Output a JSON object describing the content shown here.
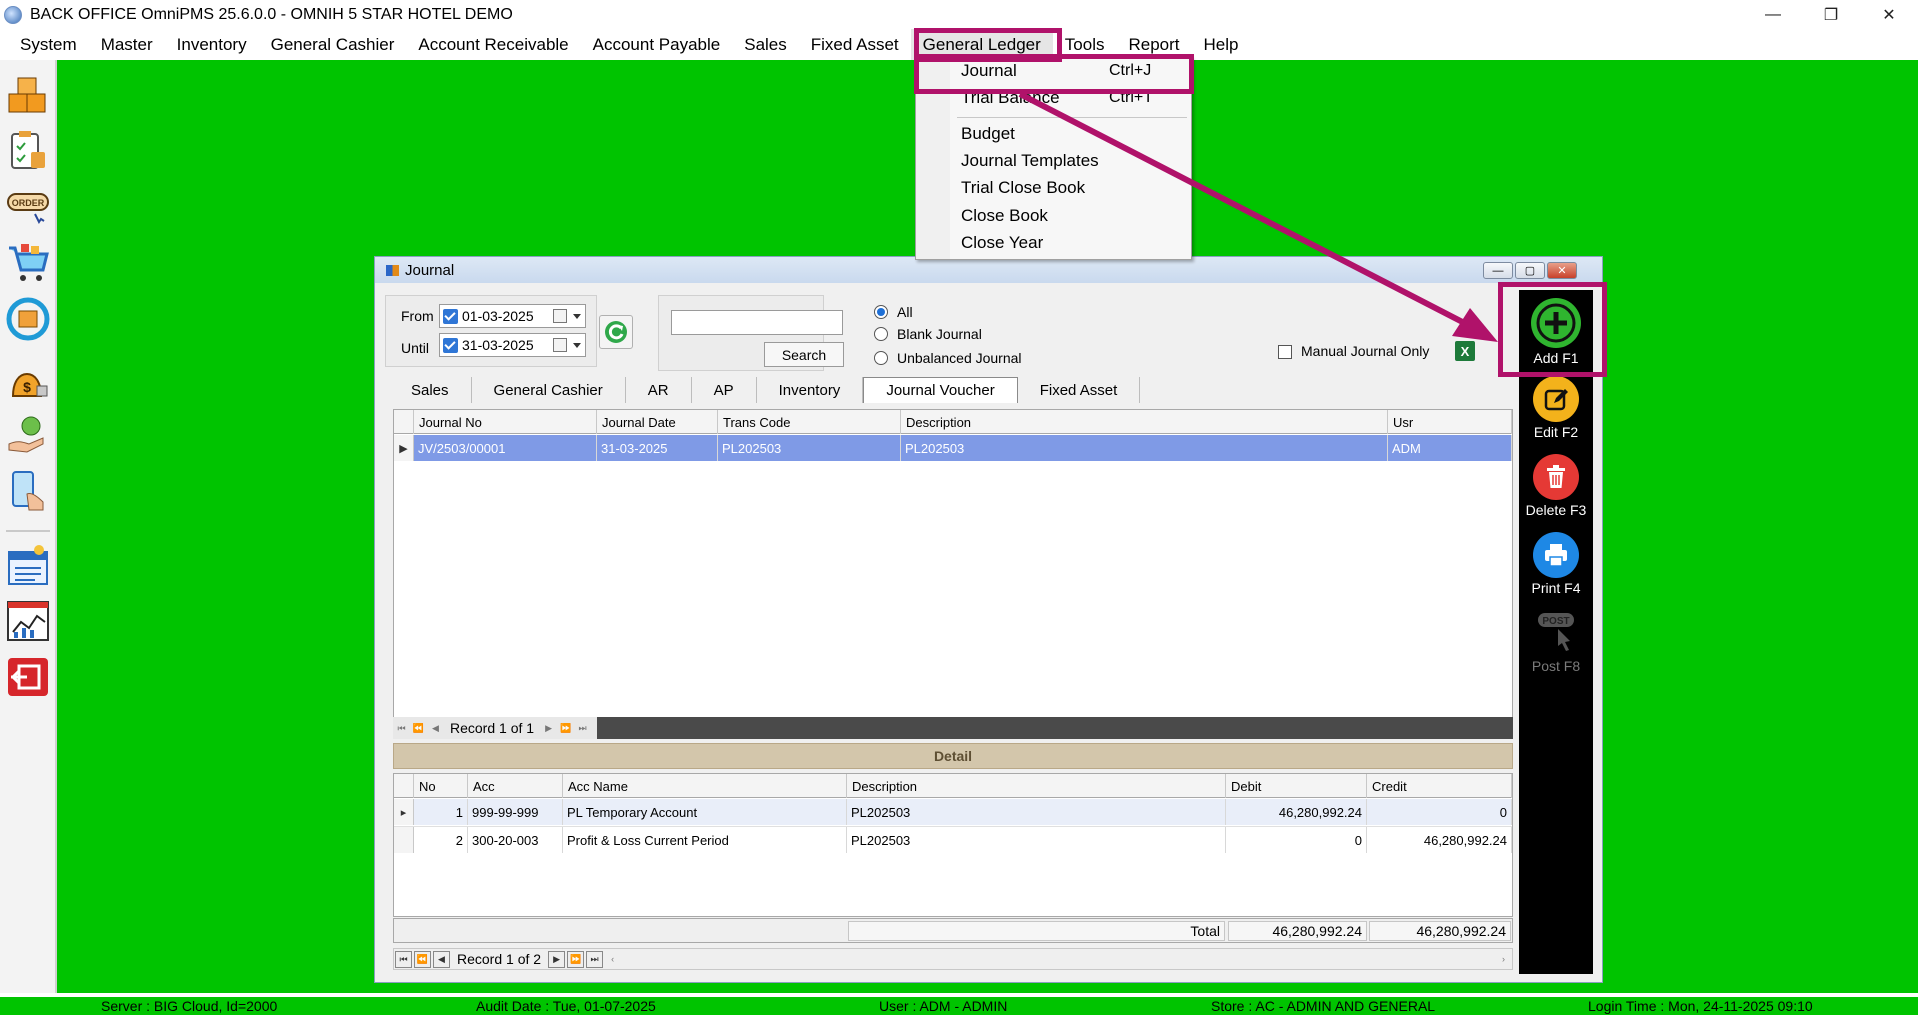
{
  "window": {
    "title": "BACK OFFICE OmniPMS 25.6.0.0 - OMNIH 5 STAR HOTEL DEMO",
    "controls": [
      "—",
      "❐",
      "✕"
    ]
  },
  "menu": [
    "System",
    "Master",
    "Inventory",
    "General Cashier",
    "Account Receivable",
    "Account Payable",
    "Sales",
    "Fixed Asset",
    "General Ledger",
    "Tools",
    "Report",
    "Help"
  ],
  "dropdown": {
    "items": [
      {
        "label": "Journal",
        "shortcut": "Ctrl+J"
      },
      {
        "label": "Trial Balance",
        "shortcut": "Ctrl+T"
      },
      {
        "label": "Budget",
        "shortcut": ""
      },
      {
        "label": "Journal Templates",
        "shortcut": ""
      },
      {
        "label": "Trial Close Book",
        "shortcut": ""
      },
      {
        "label": "Close Book",
        "shortcut": ""
      },
      {
        "label": "Close Year",
        "shortcut": ""
      }
    ]
  },
  "journal": {
    "title": "Journal",
    "from_label": "From",
    "until_label": "Until",
    "from_date": "01-03-2025",
    "until_date": "31-03-2025",
    "search_value": "",
    "search_button": "Search",
    "radio_all": "All",
    "radio_blank": "Blank Journal",
    "radio_unbalanced": "Unbalanced Journal",
    "manual_only": "Manual Journal Only",
    "tabs": [
      "Sales",
      "General Cashier",
      "AR",
      "AP",
      "Inventory",
      "Journal Voucher",
      "Fixed Asset"
    ],
    "active_tab": "Journal Voucher",
    "master_columns": [
      "Journal No",
      "Journal Date",
      "Trans Code",
      "Description",
      "Usr"
    ],
    "master_rows": [
      {
        "journal_no": "JV/2503/00001",
        "journal_date": "31-03-2025",
        "trans_code": "PL202503",
        "description": "PL202503",
        "usr": "ADM"
      }
    ],
    "master_nav": "Record 1 of 1",
    "detail_title": "Detail",
    "detail_columns": [
      "No",
      "Acc",
      "Acc Name",
      "Description",
      "Debit",
      "Credit"
    ],
    "detail_rows": [
      {
        "no": "1",
        "acc": "999-99-999",
        "acc_name": "PL Temporary Account",
        "description": "PL202503",
        "debit": "46,280,992.24",
        "credit": "0"
      },
      {
        "no": "2",
        "acc": "300-20-003",
        "acc_name": "Profit & Loss Current Period",
        "description": "PL202503",
        "debit": "0",
        "credit": "46,280,992.24"
      }
    ],
    "total_label": "Total",
    "total_debit": "46,280,992.24",
    "total_credit": "46,280,992.24",
    "detail_nav": "Record 1 of 2"
  },
  "actions": [
    {
      "label": "Add F1",
      "icon": "plus-icon",
      "color": "#2fb52f",
      "enabled": true
    },
    {
      "label": "Edit F2",
      "icon": "pencil-icon",
      "color": "#f3b21b",
      "enabled": true
    },
    {
      "label": "Delete F3",
      "icon": "trash-icon",
      "color": "#e53935",
      "enabled": true
    },
    {
      "label": "Print F4",
      "icon": "printer-icon",
      "color": "#1e88e5",
      "enabled": true
    },
    {
      "label": "Post F8",
      "icon": "post-icon",
      "color": "#555555",
      "enabled": false
    }
  ],
  "status": {
    "server": "Server : BIG Cloud, Id=2000",
    "audit": "Audit Date : Tue, 01-07-2025",
    "user": "User : ADM - ADMIN",
    "store": "Store : AC - ADMIN AND GENERAL",
    "login": "Login Time : Mon, 24-11-2025 09:10"
  },
  "colors": {
    "desktop": "#00c400",
    "highlight": "#b0126a",
    "selection": "#7f9ae6"
  }
}
